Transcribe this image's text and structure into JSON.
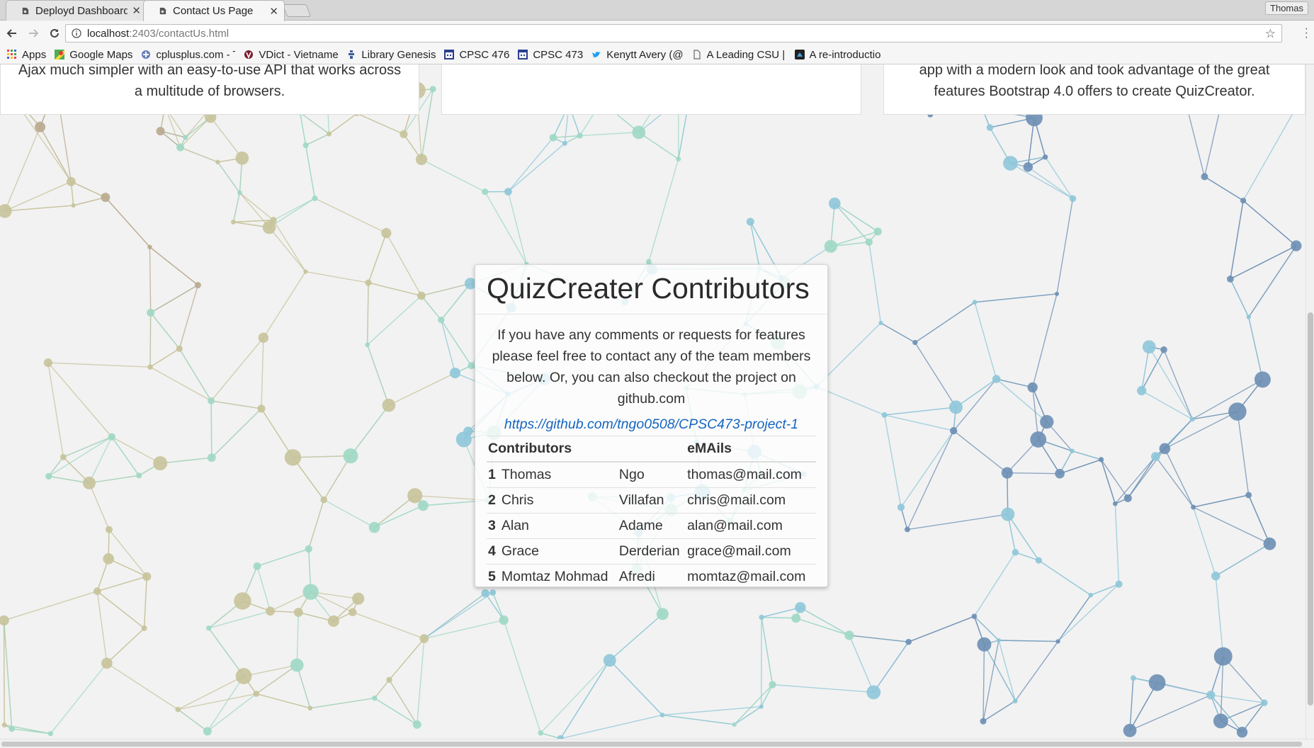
{
  "browser": {
    "tabs": [
      {
        "title": "Deployd Dashboard",
        "active": false
      },
      {
        "title": "Contact Us Page",
        "active": true
      }
    ],
    "profile_name": "Thomas",
    "address": {
      "host": "localhost",
      "path": ":2403/contactUs.html"
    },
    "bookmarks": [
      {
        "label": "Apps",
        "icon": "apps-grid-icon"
      },
      {
        "label": "Google Maps",
        "icon": "maps-pin-icon"
      },
      {
        "label": "cplusplus.com - T",
        "icon": "cplusplus-icon"
      },
      {
        "label": "VDict - Vietname",
        "icon": "vdict-icon"
      },
      {
        "label": "Library Genesis",
        "icon": "library-icon"
      },
      {
        "label": "CPSC 476",
        "icon": "calendar-icon"
      },
      {
        "label": "CPSC 473",
        "icon": "calendar-icon"
      },
      {
        "label": "Kenytt Avery (@",
        "icon": "twitter-bird-icon"
      },
      {
        "label": "A Leading CSU | C",
        "icon": "document-icon"
      },
      {
        "label": "A re-introductio",
        "icon": "mdn-icon"
      }
    ]
  },
  "feature_cards": [
    {
      "text": "Ajax much simpler with an easy-to-use API that works across a multitude of browsers."
    },
    {
      "text": ""
    },
    {
      "text": "app with a modern look and took advantage of the great features Bootstrap 4.0 offers to create QuizCreator."
    }
  ],
  "contributors_card": {
    "title": "QuizCreater Contributors",
    "intro": "If you have any comments or requests for features please feel free to contact any of the team members below. Or, you can also checkout the project on github.com",
    "repo_link": "https://github.com/tngo0508/CPSC473-project-1",
    "table": {
      "headers": [
        "Contributors",
        "",
        "eMAils"
      ],
      "rows": [
        {
          "num": "1",
          "first": "Thomas",
          "last": "Ngo",
          "email": "thomas@mail.com"
        },
        {
          "num": "2",
          "first": "Chris",
          "last": "Villafan",
          "email": "chris@mail.com"
        },
        {
          "num": "3",
          "first": "Alan",
          "last": "Adame",
          "email": "alan@mail.com"
        },
        {
          "num": "4",
          "first": "Grace",
          "last": "Derderian",
          "email": "grace@mail.com"
        },
        {
          "num": "5",
          "first": "Momtaz Mohmad",
          "last": "Afredi",
          "email": "momtaz@mail.com"
        }
      ]
    }
  },
  "colors": {
    "link": "#1565c0",
    "network_palette": [
      "#9fd8c4",
      "#c7c39a",
      "#6d8fb4",
      "#8ec6d9",
      "#b9a88e"
    ]
  }
}
